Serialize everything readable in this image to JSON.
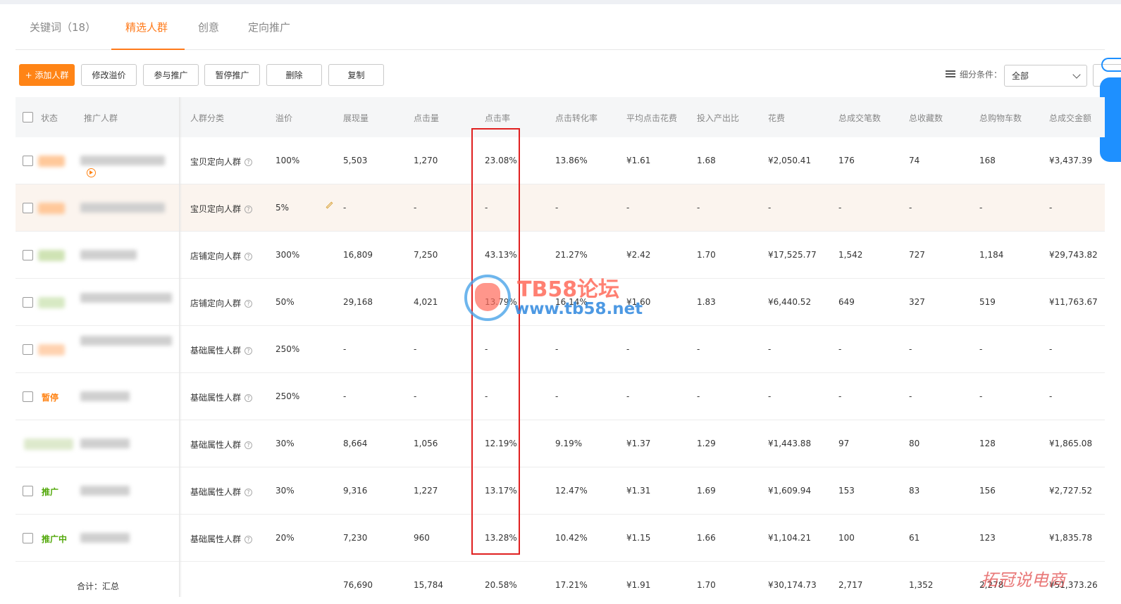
{
  "tabs": [
    {
      "label": "关键词（18）"
    },
    {
      "label": "精选人群"
    },
    {
      "label": "创意"
    },
    {
      "label": "定向推广"
    }
  ],
  "toolbar": {
    "add": "+ 添加人群",
    "edit_premium": "修改溢价",
    "join": "参与推广",
    "pause": "暂停推广",
    "delete": "删除",
    "copy": "复制",
    "filter_label": "细分条件：",
    "filter_value": "全部"
  },
  "headers": [
    "状态",
    "推广人群",
    "人群分类",
    "溢价",
    "展现量",
    "点击量",
    "点击率",
    "点击转化率",
    "平均点击花费",
    "投入产出比",
    "花费",
    "总成交笔数",
    "总收藏数",
    "总购物车数",
    "总成交金额"
  ],
  "rows": [
    {
      "status": "",
      "category": "宝贝定向人群",
      "premium": "100%",
      "impressions": "5,503",
      "clicks": "1,270",
      "ctr": "23.08%",
      "cvr": "13.86%",
      "cpc": "¥1.61",
      "roi": "1.68",
      "cost": "¥2,050.41",
      "orders": "176",
      "favs": "74",
      "carts": "168",
      "gmv": "¥3,437.39"
    },
    {
      "status": "",
      "category": "宝贝定向人群",
      "premium": "5%",
      "impressions": "-",
      "clicks": "-",
      "ctr": "-",
      "cvr": "-",
      "cpc": "-",
      "roi": "-",
      "cost": "-",
      "orders": "-",
      "favs": "-",
      "carts": "-",
      "gmv": "-"
    },
    {
      "status": "",
      "category": "店铺定向人群",
      "premium": "300%",
      "impressions": "16,809",
      "clicks": "7,250",
      "ctr": "43.13%",
      "cvr": "21.27%",
      "cpc": "¥2.42",
      "roi": "1.70",
      "cost": "¥17,525.77",
      "orders": "1,542",
      "favs": "727",
      "carts": "1,184",
      "gmv": "¥29,743.82"
    },
    {
      "status": "",
      "category": "店铺定向人群",
      "premium": "50%",
      "impressions": "29,168",
      "clicks": "4,021",
      "ctr": "13.79%",
      "cvr": "16.14%",
      "cpc": "¥1.60",
      "roi": "1.83",
      "cost": "¥6,440.52",
      "orders": "649",
      "favs": "327",
      "carts": "519",
      "gmv": "¥11,763.67"
    },
    {
      "status": "",
      "category": "基础属性人群",
      "premium": "250%",
      "impressions": "-",
      "clicks": "-",
      "ctr": "-",
      "cvr": "-",
      "cpc": "-",
      "roi": "-",
      "cost": "-",
      "orders": "-",
      "favs": "-",
      "carts": "-",
      "gmv": "-"
    },
    {
      "status": "暂停",
      "category": "基础属性人群",
      "premium": "250%",
      "impressions": "-",
      "clicks": "-",
      "ctr": "-",
      "cvr": "-",
      "cpc": "-",
      "roi": "-",
      "cost": "-",
      "orders": "-",
      "favs": "-",
      "carts": "-",
      "gmv": "-"
    },
    {
      "status": "",
      "category": "基础属性人群",
      "premium": "30%",
      "impressions": "8,664",
      "clicks": "1,056",
      "ctr": "12.19%",
      "cvr": "9.19%",
      "cpc": "¥1.37",
      "roi": "1.29",
      "cost": "¥1,443.88",
      "orders": "97",
      "favs": "80",
      "carts": "128",
      "gmv": "¥1,865.08"
    },
    {
      "status": "推广",
      "category": "基础属性人群",
      "premium": "30%",
      "impressions": "9,316",
      "clicks": "1,227",
      "ctr": "13.17%",
      "cvr": "12.47%",
      "cpc": "¥1.31",
      "roi": "1.69",
      "cost": "¥1,609.94",
      "orders": "153",
      "favs": "83",
      "carts": "156",
      "gmv": "¥2,727.52"
    },
    {
      "status": "推广中",
      "category": "基础属性人群",
      "premium": "20%",
      "impressions": "7,230",
      "clicks": "960",
      "ctr": "13.28%",
      "cvr": "10.42%",
      "cpc": "¥1.15",
      "roi": "1.66",
      "cost": "¥1,104.21",
      "orders": "100",
      "favs": "61",
      "carts": "123",
      "gmv": "¥1,835.78"
    }
  ],
  "total": {
    "label": "合计：汇总",
    "impressions": "76,690",
    "clicks": "15,784",
    "ctr": "20.58%",
    "cvr": "17.21%",
    "cpc": "¥1.91",
    "roi": "1.70",
    "cost": "¥30,174.73",
    "orders": "2,717",
    "favs": "1,352",
    "carts": "2,278",
    "gmv": "¥51,373.26"
  },
  "watermark": {
    "brand": "TB58论坛",
    "url": "www.tb58.net",
    "corner": "拓冠说电商"
  },
  "colors": {
    "accent": "#ff8416",
    "highlight_box": "#e02020",
    "status_active": "#52a80a",
    "status_paused": "#ff8416"
  }
}
